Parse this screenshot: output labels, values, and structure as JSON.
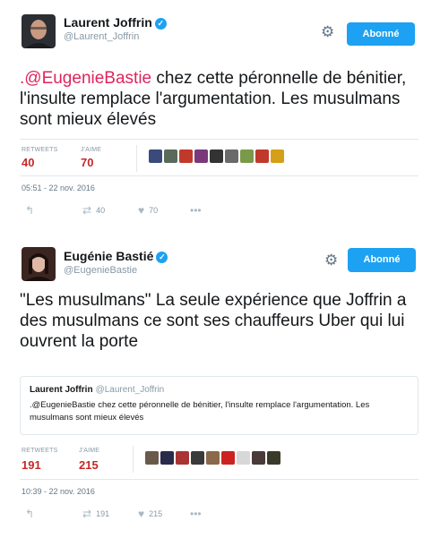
{
  "tweets": [
    {
      "author_name": "Laurent Joffrin",
      "author_handle": "@Laurent_Joffrin",
      "follow_label": "Abonné",
      "text_mention": ".@EugenieBastie",
      "text_body": " chez cette péronnelle de bénitier, l'insulte remplace l'argumentation. Les musulmans sont mieux élevés",
      "retweets_label": "RETWEETS",
      "retweets_count": "40",
      "likes_label": "J'AIME",
      "likes_count": "70",
      "timestamp": "05:51 - 22 nov. 2016",
      "actions": {
        "retweet_count": "40",
        "like_count": "70"
      }
    },
    {
      "author_name": "Eugénie Bastié",
      "author_handle": "@EugenieBastie",
      "follow_label": "Abonné",
      "text_body": "\"Les musulmans\" La seule expérience que Joffrin a des musulmans ce sont ses chauffeurs Uber qui lui ouvrent la porte",
      "quoted": {
        "author_name": "Laurent Joffrin",
        "author_handle": "@Laurent_Joffrin",
        "text": ".@EugenieBastie chez cette péronnelle de bénitier, l'insulte remplace l'argumentation. Les musulmans sont mieux élevés"
      },
      "retweets_label": "RETWEETS",
      "retweets_count": "191",
      "likes_label": "J'AIME",
      "likes_count": "215",
      "timestamp": "10:39 - 22 nov. 2016",
      "actions": {
        "retweet_count": "191",
        "like_count": "215"
      }
    }
  ],
  "icons": {
    "reply": "reply-icon",
    "retweet": "retweet-icon",
    "like": "heart-icon",
    "more": "more-icon",
    "settings": "gear-icon",
    "verified": "verified-badge-icon"
  },
  "colors": {
    "accent": "#1da1f2",
    "mention": "#e0245e",
    "count": "#c62828"
  },
  "glyphs": {
    "verified": "✓",
    "gear": "⚙",
    "reply": "↰",
    "retweet": "⇄",
    "like": "♥",
    "more": "•••"
  },
  "likers_1": [
    "#3a4a7a",
    "#5a6a5a",
    "#c0392b",
    "#7a3a7a",
    "#333333",
    "#6a6a6a",
    "#7a9a4a",
    "#c0392b",
    "#d4a017"
  ],
  "likers_2": [
    "#6a5a4a",
    "#2a2a4a",
    "#aa3333",
    "#3a3a3a",
    "#8a6a4a",
    "#cc2222",
    "#d8d8d8",
    "#4a3a3a",
    "#3a3a2a"
  ]
}
